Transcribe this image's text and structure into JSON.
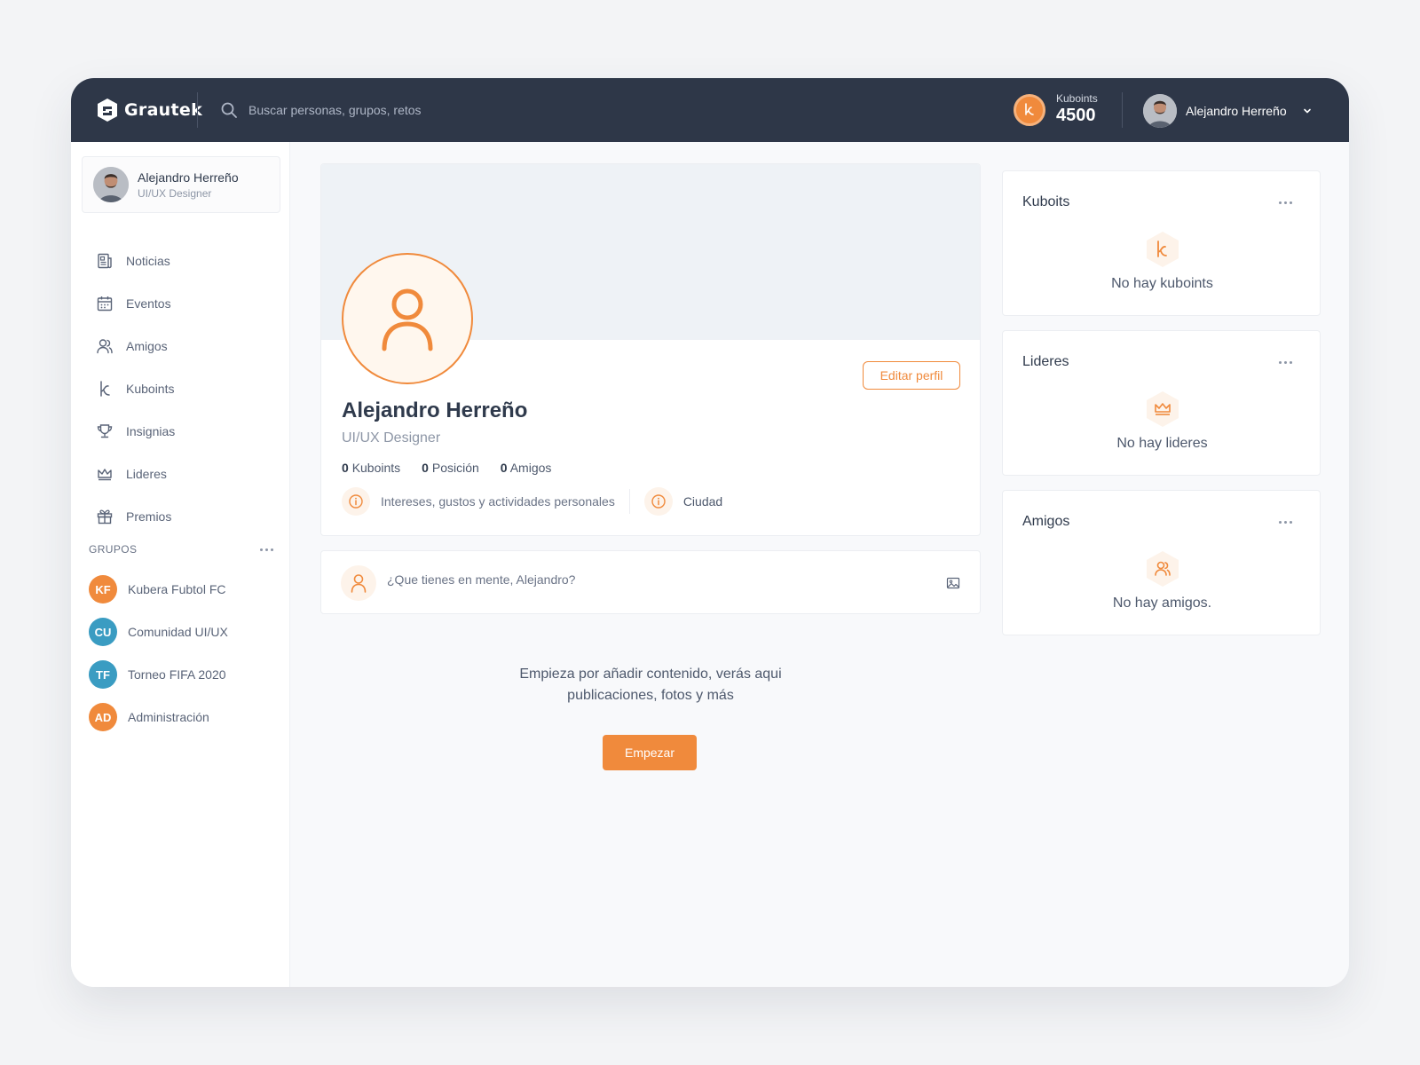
{
  "app": {
    "name": "Grautek"
  },
  "search": {
    "placeholder": "Buscar personas, grupos, retos"
  },
  "topbar": {
    "kuboints_label": "Kuboints",
    "kuboints_value": "4500",
    "user_name": "Alejandro Herreño"
  },
  "sidebar": {
    "profile": {
      "name": "Alejandro Herreño",
      "role": "UI/UX Designer"
    },
    "nav": [
      {
        "label": "Noticias",
        "icon": "news-icon"
      },
      {
        "label": "Eventos",
        "icon": "calendar-icon"
      },
      {
        "label": "Amigos",
        "icon": "friends-icon"
      },
      {
        "label": "Kuboints",
        "icon": "kuboints-icon"
      },
      {
        "label": "Insignias",
        "icon": "trophy-icon"
      },
      {
        "label": "Lideres",
        "icon": "crown-icon"
      },
      {
        "label": "Premios",
        "icon": "gift-icon"
      }
    ],
    "groups_title": "GRUPOS",
    "groups": [
      {
        "initials": "KF",
        "label": "Kubera Fubtol FC",
        "color": "#f08a3c"
      },
      {
        "initials": "CU",
        "label": "Comunidad UI/UX",
        "color": "#3a9cc2"
      },
      {
        "initials": "TF",
        "label": "Torneo FIFA 2020",
        "color": "#3a9cc2"
      },
      {
        "initials": "AD",
        "label": "Administración",
        "color": "#f08a3c"
      }
    ]
  },
  "profile": {
    "name": "Alejandro Herreño",
    "role": "UI/UX Designer",
    "edit_label": "Editar perfil",
    "stats": [
      {
        "value": "0",
        "label": "Kuboints"
      },
      {
        "value": "0",
        "label": "Posición"
      },
      {
        "value": "0",
        "label": "Amigos"
      }
    ],
    "info": [
      {
        "label": "Intereses, gustos y actividades personales"
      },
      {
        "label": "Ciudad"
      }
    ]
  },
  "composer": {
    "placeholder": "¿Que tienes en mente, Alejandro?"
  },
  "empty_feed": {
    "line1": "Empieza por añadir contenido, verás aqui",
    "line2": "publicaciones, fotos y más",
    "button": "Empezar"
  },
  "widgets": [
    {
      "title": "Kuboits",
      "empty": "No hay kuboints",
      "icon": "kuboints-icon"
    },
    {
      "title": "Lideres",
      "empty": "No hay lideres",
      "icon": "crown-icon"
    },
    {
      "title": "Amigos",
      "empty": "No hay amigos.",
      "icon": "friends-icon"
    }
  ],
  "colors": {
    "accent": "#f08a3c",
    "topbar": "#2e3748",
    "teal": "#3a9cc2"
  }
}
